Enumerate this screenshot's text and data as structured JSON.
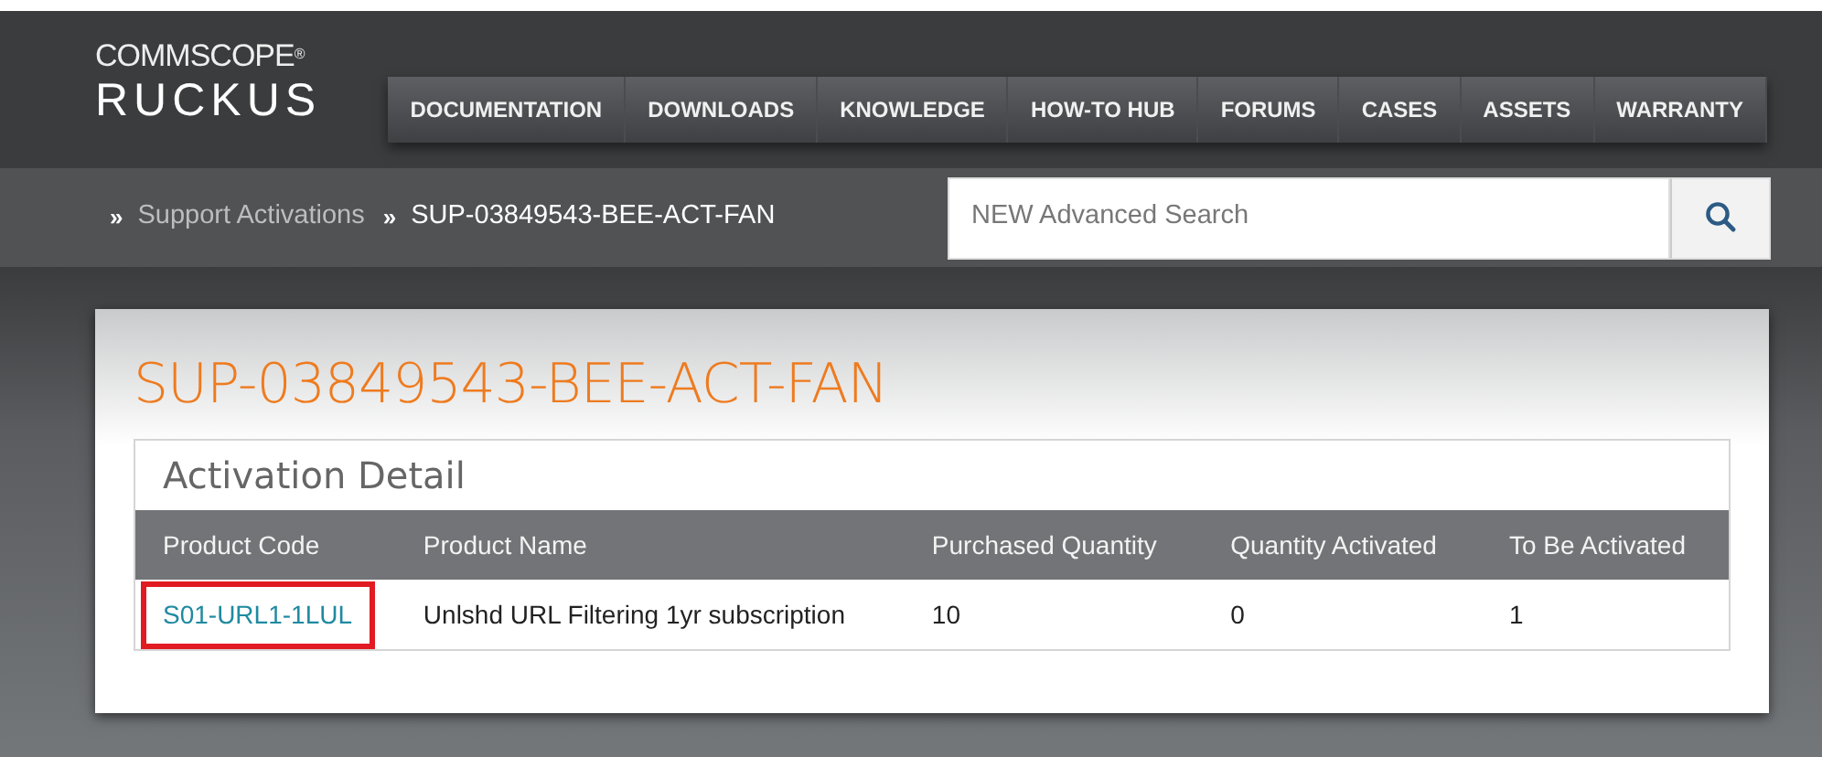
{
  "logo": {
    "brand_top": "COMMSCOPE",
    "brand_mark": "®",
    "brand_main": "RUCKUS"
  },
  "nav": [
    {
      "label": "DOCUMENTATION"
    },
    {
      "label": "DOWNLOADS"
    },
    {
      "label": "KNOWLEDGE"
    },
    {
      "label": "HOW-TO HUB"
    },
    {
      "label": "FORUMS"
    },
    {
      "label": "CASES"
    },
    {
      "label": "ASSETS"
    },
    {
      "label": "WARRANTY"
    }
  ],
  "breadcrumb": [
    {
      "separator": "»",
      "label": "Support Activations",
      "link": true
    },
    {
      "separator": "»",
      "label": "SUP-03849543-BEE-ACT-FAN",
      "link": false
    }
  ],
  "search": {
    "placeholder": "NEW Advanced Search"
  },
  "page_title": "SUP-03849543-BEE-ACT-FAN",
  "panel": {
    "title": "Activation Detail",
    "table": {
      "columns": [
        "Product Code",
        "Product Name",
        "Purchased Quantity",
        "Quantity Activated",
        "To Be Activated"
      ],
      "rows": [
        {
          "cells": [
            "S01-URL1-1LUL",
            "Unlshd URL Filtering 1yr subscription",
            "10",
            "0",
            "1"
          ],
          "highlighted": true
        }
      ]
    }
  }
}
